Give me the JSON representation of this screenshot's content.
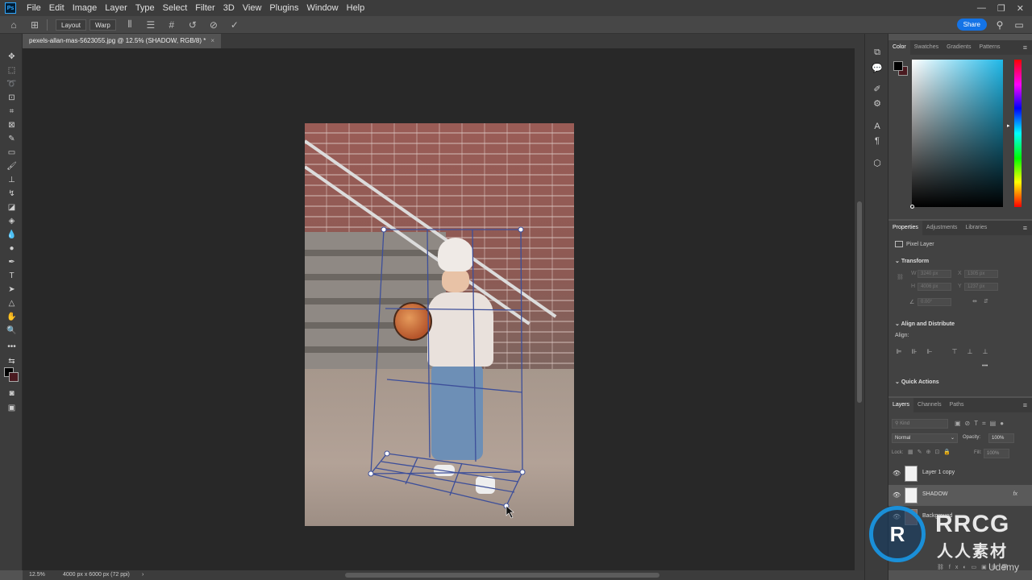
{
  "menubar": {
    "logo": "Ps",
    "items": [
      "File",
      "Edit",
      "Image",
      "Layer",
      "Type",
      "Select",
      "Filter",
      "3D",
      "View",
      "Plugins",
      "Window",
      "Help"
    ]
  },
  "options": {
    "layout_label": "Layout",
    "warp_label": "Warp",
    "share_label": "Share"
  },
  "document": {
    "tab_title": "pexels-allan-mas-5623055.jpg @ 12.5% (SHADOW, RGB/8) *",
    "tab_close": "×"
  },
  "status": {
    "zoom": "12.5%",
    "info": "4000 px x 6000 px (72 ppi)",
    "arrow": "›"
  },
  "color_panel": {
    "tabs": [
      "Color",
      "Swatches",
      "Gradients",
      "Patterns"
    ],
    "fg_color": "#000000",
    "bg_color": "#4a1a20"
  },
  "properties_panel": {
    "tabs": [
      "Properties",
      "Adjustments",
      "Libraries"
    ],
    "kind": "Pixel Layer",
    "transform_title": "Transform",
    "w_label": "W",
    "w_value": "3240 px",
    "h_label": "H",
    "h_value": "4006 px",
    "x_label": "X",
    "x_value": "1305 px",
    "y_label": "Y",
    "y_value": "1237 px",
    "angle_value": "0.00°",
    "align_title": "Align and Distribute",
    "align_label": "Align:",
    "more": "•••",
    "quick_actions": "Quick Actions"
  },
  "layers_panel": {
    "tabs": [
      "Layers",
      "Channels",
      "Paths"
    ],
    "search_placeholder": "Kind",
    "blend_mode": "Normal",
    "opacity_label": "Opacity:",
    "opacity_value": "100%",
    "lock_label": "Lock:",
    "fill_label": "Fill:",
    "fill_value": "100%",
    "layers": [
      {
        "name": "Layer 1 copy",
        "selected": false,
        "fx": ""
      },
      {
        "name": "SHADOW",
        "selected": true,
        "fx": "fx"
      },
      {
        "name": "Background",
        "selected": false,
        "fx": ""
      }
    ]
  },
  "watermark": {
    "logo": "R",
    "title": "RRCG",
    "subtitle": "人人素材",
    "udemy": "Udemy"
  }
}
